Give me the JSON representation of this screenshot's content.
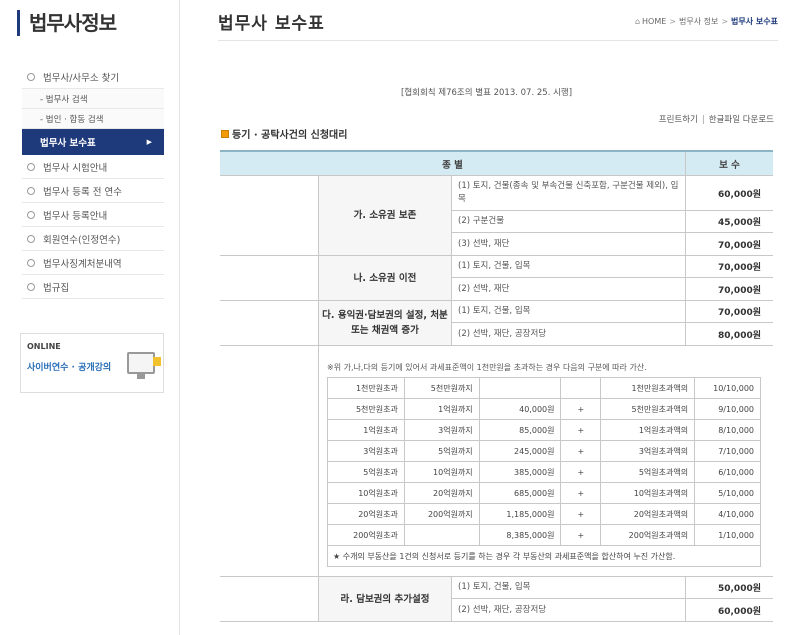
{
  "sidebar": {
    "title": "법무사정보",
    "menu": [
      {
        "label": "법무사/사무소 찾기"
      },
      {
        "label": "- 법무사 검색"
      },
      {
        "label": "- 법인 · 합동 검색"
      },
      {
        "label": "법무사 보수표"
      },
      {
        "label": "법무사 시험안내"
      },
      {
        "label": "법무사 등록 전 연수"
      },
      {
        "label": "법무사 등록안내"
      },
      {
        "label": "회원연수(인정연수)"
      },
      {
        "label": "법무사징계처분내역"
      },
      {
        "label": "법규집"
      }
    ],
    "online": {
      "label": "ONLINE",
      "text": "사이버연수 · 공개강의"
    }
  },
  "header": {
    "title": "법무사 보수표",
    "breadcrumb": [
      "HOME",
      "법무사 정보",
      "법무사 보수표"
    ]
  },
  "notice": "[협회회칙 제76조의 별표 2013. 07. 25. 시행]",
  "actions": {
    "print": "프린트하기",
    "download": "한글파일 다운로드"
  },
  "section_title": "등기 · 공탁사건의 신청대리",
  "table": {
    "headers": [
      "종 별",
      "보 수"
    ],
    "groups": [
      {
        "name": "가. 소유권 보존",
        "rows": [
          {
            "desc": "(1) 토지, 건물(종속 및 부속건물 신축포함, 구분건물 제외), 입목",
            "fee": "60,000원"
          },
          {
            "desc": "(2) 구분건물",
            "fee": "45,000원"
          },
          {
            "desc": "(3) 선박, 재단",
            "fee": "70,000원"
          }
        ]
      },
      {
        "name": "나. 소유권 이전",
        "rows": [
          {
            "desc": "(1) 토지, 건물, 입목",
            "fee": "70,000원"
          },
          {
            "desc": "(2) 선박, 재단",
            "fee": "70,000원"
          }
        ]
      },
      {
        "name": "다. 용익권·담보권의 설정, 처분 또는 채권액 증가",
        "rows": [
          {
            "desc": "(1) 토지, 건물, 입목",
            "fee": "70,000원"
          },
          {
            "desc": "(2) 선박, 재단, 공장저당",
            "fee": "80,000원"
          }
        ]
      }
    ],
    "surcharge": {
      "note": "※위 가,나,다의 등기에 있어서 과세표준액이 1천만원을 초과하는 경우 다음의 구분에 따라 가산.",
      "rows": [
        [
          "1천만원초과",
          "5천만원까지",
          "",
          "",
          "1천만원초과액의",
          "10/10,000"
        ],
        [
          "5천만원초과",
          "1억원까지",
          "40,000원",
          "+",
          "5천만원초과액의",
          "9/10,000"
        ],
        [
          "1억원초과",
          "3억원까지",
          "85,000원",
          "+",
          "1억원초과액의",
          "8/10,000"
        ],
        [
          "3억원초과",
          "5억원까지",
          "245,000원",
          "+",
          "3억원초과액의",
          "7/10,000"
        ],
        [
          "5억원초과",
          "10억원까지",
          "385,000원",
          "+",
          "5억원초과액의",
          "6/10,000"
        ],
        [
          "10억원초과",
          "20억원까지",
          "685,000원",
          "+",
          "10억원초과액의",
          "5/10,000"
        ],
        [
          "20억원초과",
          "200억원까지",
          "1,185,000원",
          "+",
          "20억원초과액의",
          "4/10,000"
        ],
        [
          "200억원초과",
          "",
          "8,385,000원",
          "+",
          "200억원초과액의",
          "1/10,000"
        ]
      ],
      "footnote": "★ 수개의 부동산을 1건의 신청서로 등기를 하는 경우 각 부동산의 과세표준액을 합산하여 누진 가산함."
    },
    "last_group": {
      "name": "라. 담보권의 추가설정",
      "rows": [
        {
          "desc": "(1) 토지, 건물, 입목",
          "fee": "50,000원"
        },
        {
          "desc": "(2) 선박, 재단, 공장저당",
          "fee": "60,000원"
        }
      ]
    }
  }
}
